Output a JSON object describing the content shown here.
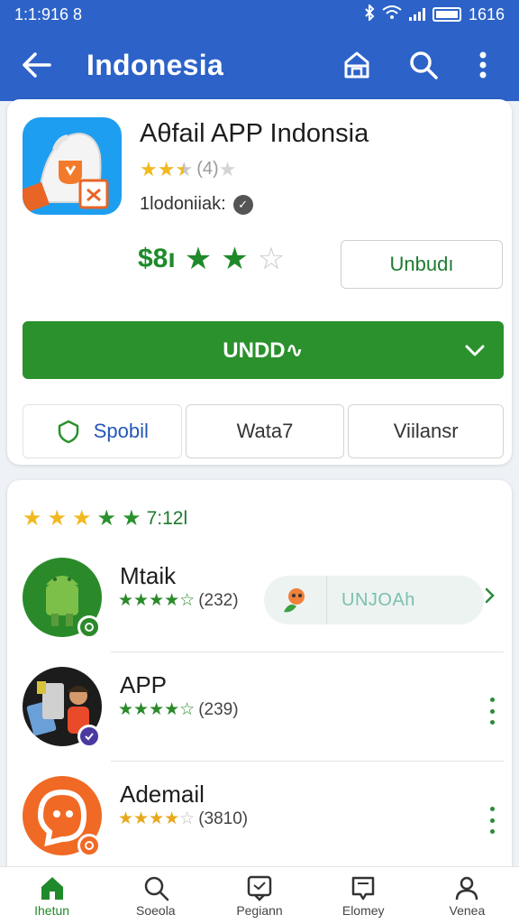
{
  "status_bar": {
    "time": "1:1:916 8",
    "right_text": "1616"
  },
  "app_bar": {
    "title": "Indonesia"
  },
  "app": {
    "name": "Aθfail APP Indonsia",
    "rating_count": "(4)",
    "developer": "1lodoniiak:",
    "price": "$8ı",
    "secondary_button": "Unbudı",
    "install_button": "UNDD∿",
    "accent": "#2a912d"
  },
  "tabs": [
    {
      "label": "Spobil",
      "icon": "shield-icon"
    },
    {
      "label": "Wata7"
    },
    {
      "label": "Viilansr"
    }
  ],
  "section": {
    "rating_label": "7:12l"
  },
  "list": [
    {
      "name": "Mtaik",
      "count": "(232)",
      "action": "UNJOAh"
    },
    {
      "name": "APP",
      "count": "(239)"
    },
    {
      "name": "Ademail",
      "count": "(3810)"
    }
  ],
  "bottom_nav": [
    {
      "label": "Ihetun",
      "icon": "home-icon"
    },
    {
      "label": "Soeola",
      "icon": "search-icon"
    },
    {
      "label": "Pegiann",
      "icon": "chat-icon"
    },
    {
      "label": "Elomey",
      "icon": "book-icon"
    },
    {
      "label": "Venea",
      "icon": "person-icon"
    }
  ]
}
